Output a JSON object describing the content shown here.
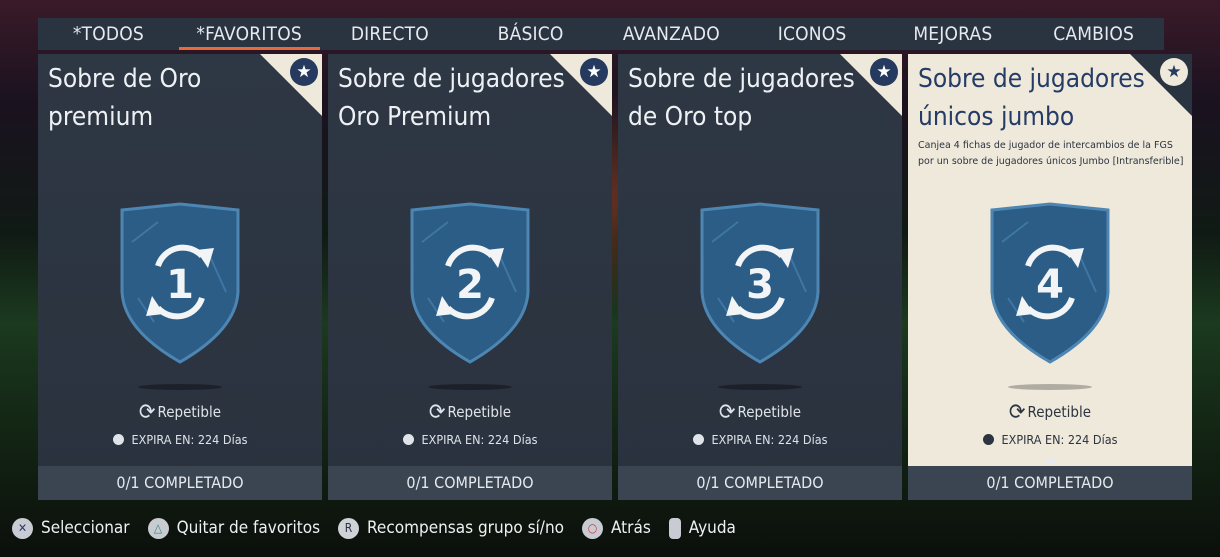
{
  "tabs": [
    {
      "label": "*TODOS",
      "active": false
    },
    {
      "label": "*FAVORITOS",
      "active": true
    },
    {
      "label": "DIRECTO",
      "active": false
    },
    {
      "label": "BÁSICO",
      "active": false
    },
    {
      "label": "AVANZADO",
      "active": false
    },
    {
      "label": "ICONOS",
      "active": false
    },
    {
      "label": "MEJORAS",
      "active": false
    },
    {
      "label": "CAMBIOS",
      "active": false
    }
  ],
  "cards": [
    {
      "title": "Sobre de Oro premium",
      "description": "",
      "badge_number": "1",
      "repeat_label": "Repetible",
      "expire_label": "EXPIRA EN: 224 Días",
      "progress_label": "0/1 COMPLETADO",
      "selected": false
    },
    {
      "title": "Sobre de jugadores Oro Premium",
      "description": "",
      "badge_number": "2",
      "repeat_label": "Repetible",
      "expire_label": "EXPIRA EN: 224 Días",
      "progress_label": "0/1 COMPLETADO",
      "selected": false
    },
    {
      "title": "Sobre de jugadores de Oro top",
      "description": "",
      "badge_number": "3",
      "repeat_label": "Repetible",
      "expire_label": "EXPIRA EN: 224 Días",
      "progress_label": "0/1 COMPLETADO",
      "selected": false
    },
    {
      "title": "Sobre de jugadores únicos jumbo",
      "description": "Canjea 4 fichas de jugador de intercambios de la FGS por un sobre de jugadores únicos Jumbo [Intransferible]",
      "badge_number": "4",
      "repeat_label": "Repetible",
      "expire_label": "EXPIRA EN: 224 Días",
      "progress_label": "0/1 COMPLETADO",
      "selected": true
    }
  ],
  "footer": {
    "select": {
      "icon": "cross-button-icon",
      "label": "Seleccionar"
    },
    "favorites": {
      "icon": "triangle-button-icon",
      "label": "Quitar de favoritos"
    },
    "rewards": {
      "icon": "right-stick-icon",
      "glyph": "R",
      "label": "Recompensas grupo sí/no"
    },
    "back": {
      "icon": "circle-button-icon",
      "label": "Atrás"
    },
    "help": {
      "icon": "touchpad-icon",
      "label": "Ayuda"
    }
  },
  "colors": {
    "accent": "#e8693a",
    "card_bg": "#2e3744",
    "card_selected_bg": "#efe9db",
    "shield_blue": "#2b5d86",
    "title_selected": "#253c66"
  }
}
